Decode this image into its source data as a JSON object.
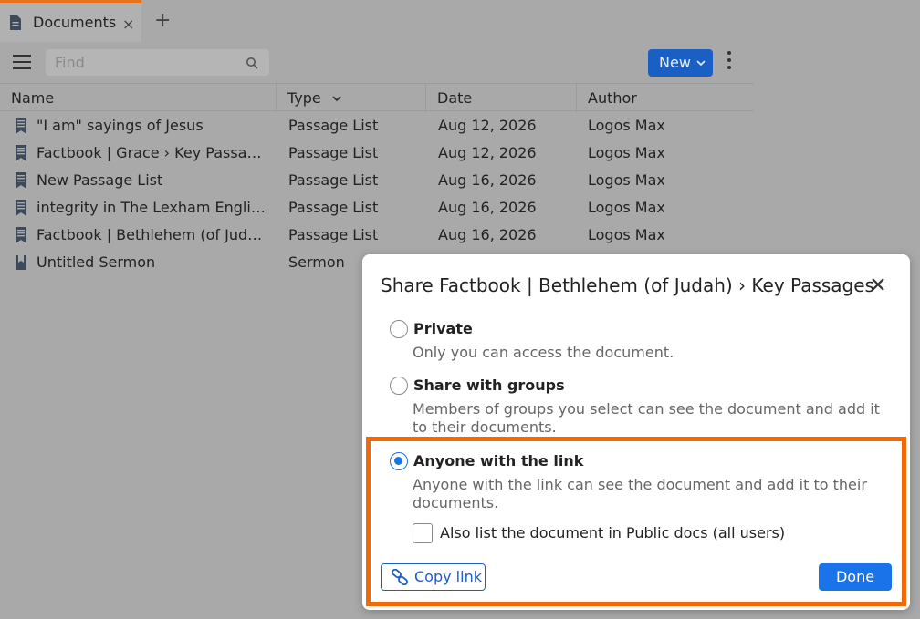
{
  "tab": {
    "title": "Documents",
    "close": "×",
    "add": "+"
  },
  "toolbar": {
    "find_placeholder": "Find",
    "new_label": "New"
  },
  "columns": [
    "Name",
    "Type",
    "Date",
    "Author"
  ],
  "rows": [
    {
      "name": "\"I am\" sayings of Jesus",
      "type": "Passage List",
      "date": "Aug 12, 2026",
      "author": "Logos Max",
      "icon": "passage-list-icon"
    },
    {
      "name": "Factbook | Grace › Key Passages",
      "type": "Passage List",
      "date": "Aug 12, 2026",
      "author": "Logos Max",
      "icon": "passage-list-icon"
    },
    {
      "name": "New Passage List",
      "type": "Passage List",
      "date": "Aug 16, 2026",
      "author": "Logos Max",
      "icon": "passage-list-icon"
    },
    {
      "name": "integrity in The Lexham English …",
      "type": "Passage List",
      "date": "Aug 16, 2026",
      "author": "Logos Max",
      "icon": "passage-list-icon"
    },
    {
      "name": "Factbook | Bethlehem (of Judah…",
      "type": "Passage List",
      "date": "Aug 16, 2026",
      "author": "Logos Max",
      "icon": "passage-list-icon"
    },
    {
      "name": "Untitled Sermon",
      "type": "Sermon",
      "date": "",
      "author": "",
      "icon": "sermon-icon"
    }
  ],
  "dialog": {
    "title": "Share Factbook | Bethlehem (of Judah) › Key Passages",
    "options": [
      {
        "label": "Private",
        "desc": "Only you can access the document.",
        "checked": false
      },
      {
        "label": "Share with groups",
        "desc": "Members of groups you select can see the document and add it to their documents.",
        "checked": false
      },
      {
        "label": "Anyone with the link",
        "desc": "Anyone with the link can see the document and add it to their documents.",
        "checked": true
      }
    ],
    "checkbox_label": "Also list the document in Public docs (all users)",
    "copy_link_label": "Copy link",
    "done_label": "Done"
  },
  "colors": {
    "accent": "#1a73e8",
    "highlight": "#ef6a0a",
    "tab_accent": "#e8711d"
  }
}
